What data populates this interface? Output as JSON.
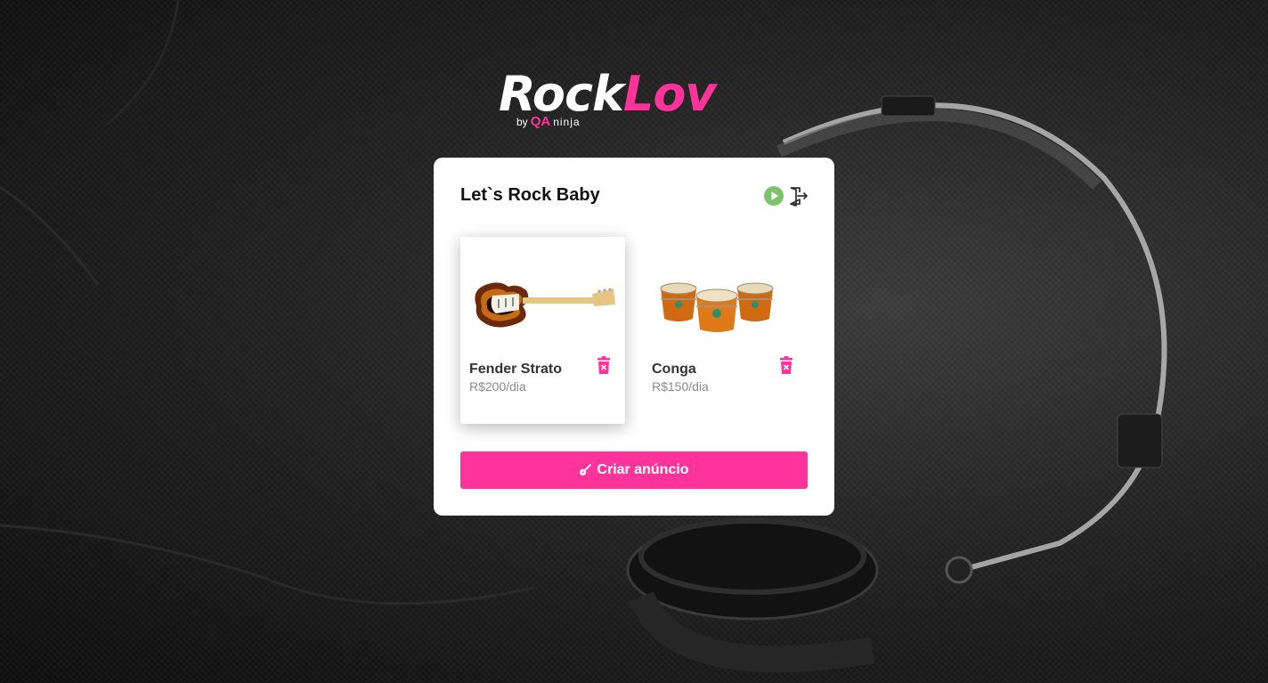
{
  "brand": {
    "rock": "Rock",
    "lov": "Lov",
    "by": "by",
    "qa": "QA",
    "ninja": "ninja"
  },
  "dashboard": {
    "title": "Let`s Rock Baby",
    "icons": [
      "play-icon",
      "logout-icon"
    ]
  },
  "listings": [
    {
      "name": "Fender Strato",
      "price": "R$200/dia",
      "image": "guitar-image"
    },
    {
      "name": "Conga",
      "price": "R$150/dia",
      "image": "conga-image"
    }
  ],
  "actions": {
    "create_label": "Criar anúncio",
    "create_icon": "guitar-icon"
  },
  "colors": {
    "accent": "#ff3399",
    "play": "#7cc46b"
  }
}
